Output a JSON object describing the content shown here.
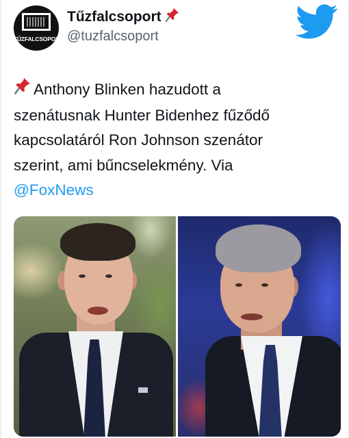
{
  "header": {
    "avatar_text": "TŰZFALCSOPORT",
    "display_name": "Tűzfalcsoport",
    "handle": "@tuzfalcsoport",
    "pin_icon": "pushpin-icon",
    "bird_icon": "twitter-bird-icon",
    "brand_color": "#1d9bf0"
  },
  "tweet": {
    "lines": [
      "Anthony Blinken hazudott a",
      "szenátusnak Hunter Bidenhez fűződő",
      "kapcsolatáról Ron Johnson szenátor",
      "szerint, ami bűncselekmény. Via"
    ],
    "mention": "@FoxNews",
    "mention_color": "#1d9bf0"
  },
  "media": {
    "left_photo": "portrait-man-dark-suit-outdoor-background",
    "right_photo": "portrait-man-gray-hair-blue-background"
  }
}
